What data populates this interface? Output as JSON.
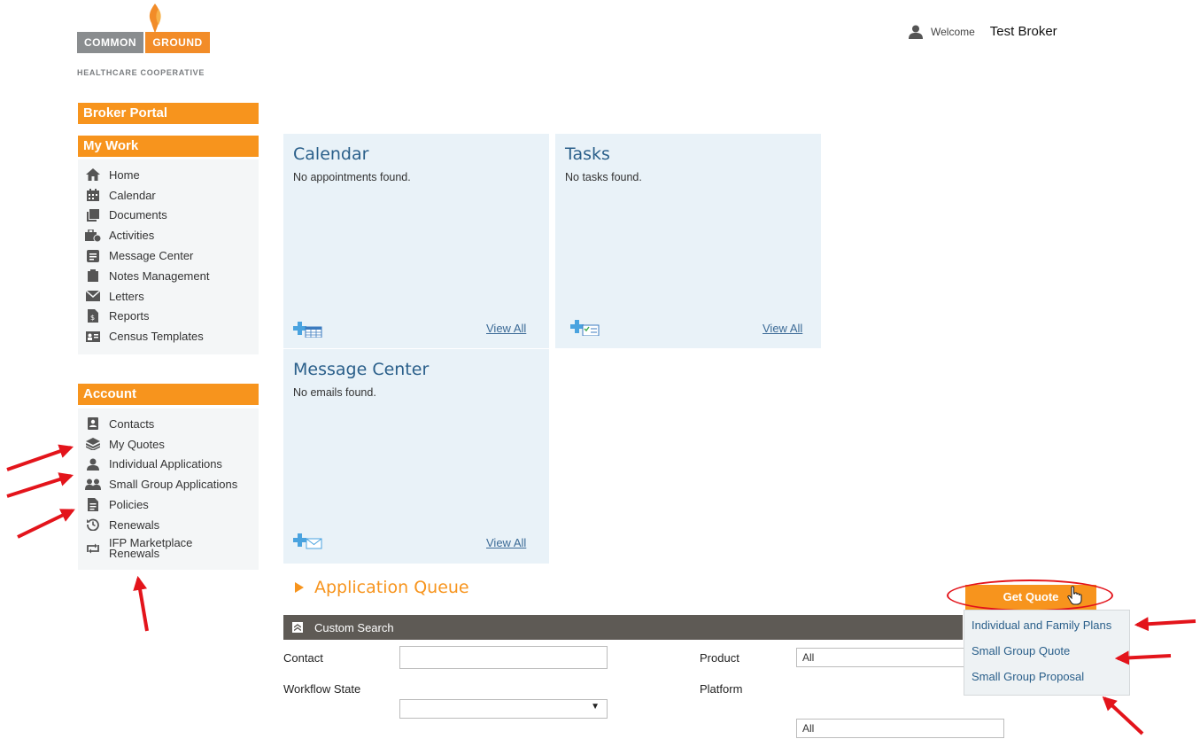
{
  "logo": {
    "left": "COMMON",
    "right": "GROUND",
    "sub": "HEALTHCARE COOPERATIVE"
  },
  "header": {
    "welcome": "Welcome",
    "user": "Test Broker"
  },
  "sidebar": {
    "portal_title": "Broker Portal",
    "my_work_title": "My Work",
    "my_work": [
      {
        "label": "Home",
        "icon": "home-icon"
      },
      {
        "label": "Calendar",
        "icon": "calendar-icon"
      },
      {
        "label": "Documents",
        "icon": "documents-icon"
      },
      {
        "label": "Activities",
        "icon": "activities-icon"
      },
      {
        "label": "Message Center",
        "icon": "message-icon"
      },
      {
        "label": "Notes Management",
        "icon": "clipboard-icon"
      },
      {
        "label": "Letters",
        "icon": "envelope-icon"
      },
      {
        "label": "Reports",
        "icon": "report-icon"
      },
      {
        "label": "Census Templates",
        "icon": "id-card-icon"
      }
    ],
    "account_title": "Account",
    "account": [
      {
        "label": "Contacts",
        "icon": "contact-icon"
      },
      {
        "label": "My Quotes",
        "icon": "layers-icon"
      },
      {
        "label": "Individual Applications",
        "icon": "user-icon"
      },
      {
        "label": "Small Group Applications",
        "icon": "users-icon"
      },
      {
        "label": "Policies",
        "icon": "policy-icon"
      },
      {
        "label": "Renewals",
        "icon": "history-icon"
      },
      {
        "label": "IFP Marketplace Renewals",
        "icon": "retweet-icon"
      }
    ]
  },
  "widgets": {
    "calendar": {
      "title": "Calendar",
      "empty": "No appointments found.",
      "view_all": "View All"
    },
    "tasks": {
      "title": "Tasks",
      "empty": "No tasks found.",
      "view_all": "View All"
    },
    "messages": {
      "title": "Message Center",
      "empty": "No emails found.",
      "view_all": "View All"
    }
  },
  "queue": {
    "title": "Application Queue",
    "custom_search": "Custom Search",
    "fields": {
      "contact": "Contact",
      "workflow": "Workflow State",
      "product": "Product",
      "product_value": "All",
      "platform": "Platform",
      "platform_value": "All"
    }
  },
  "quote": {
    "button": "Get Quote",
    "menu": [
      "Individual and Family Plans",
      "Small Group Quote",
      "Small Group Proposal"
    ]
  },
  "colors": {
    "accent": "#f7941d",
    "widget_bg": "#e9f2f8",
    "title_blue": "#2a5f8a",
    "annotation_red": "#e3141b"
  }
}
